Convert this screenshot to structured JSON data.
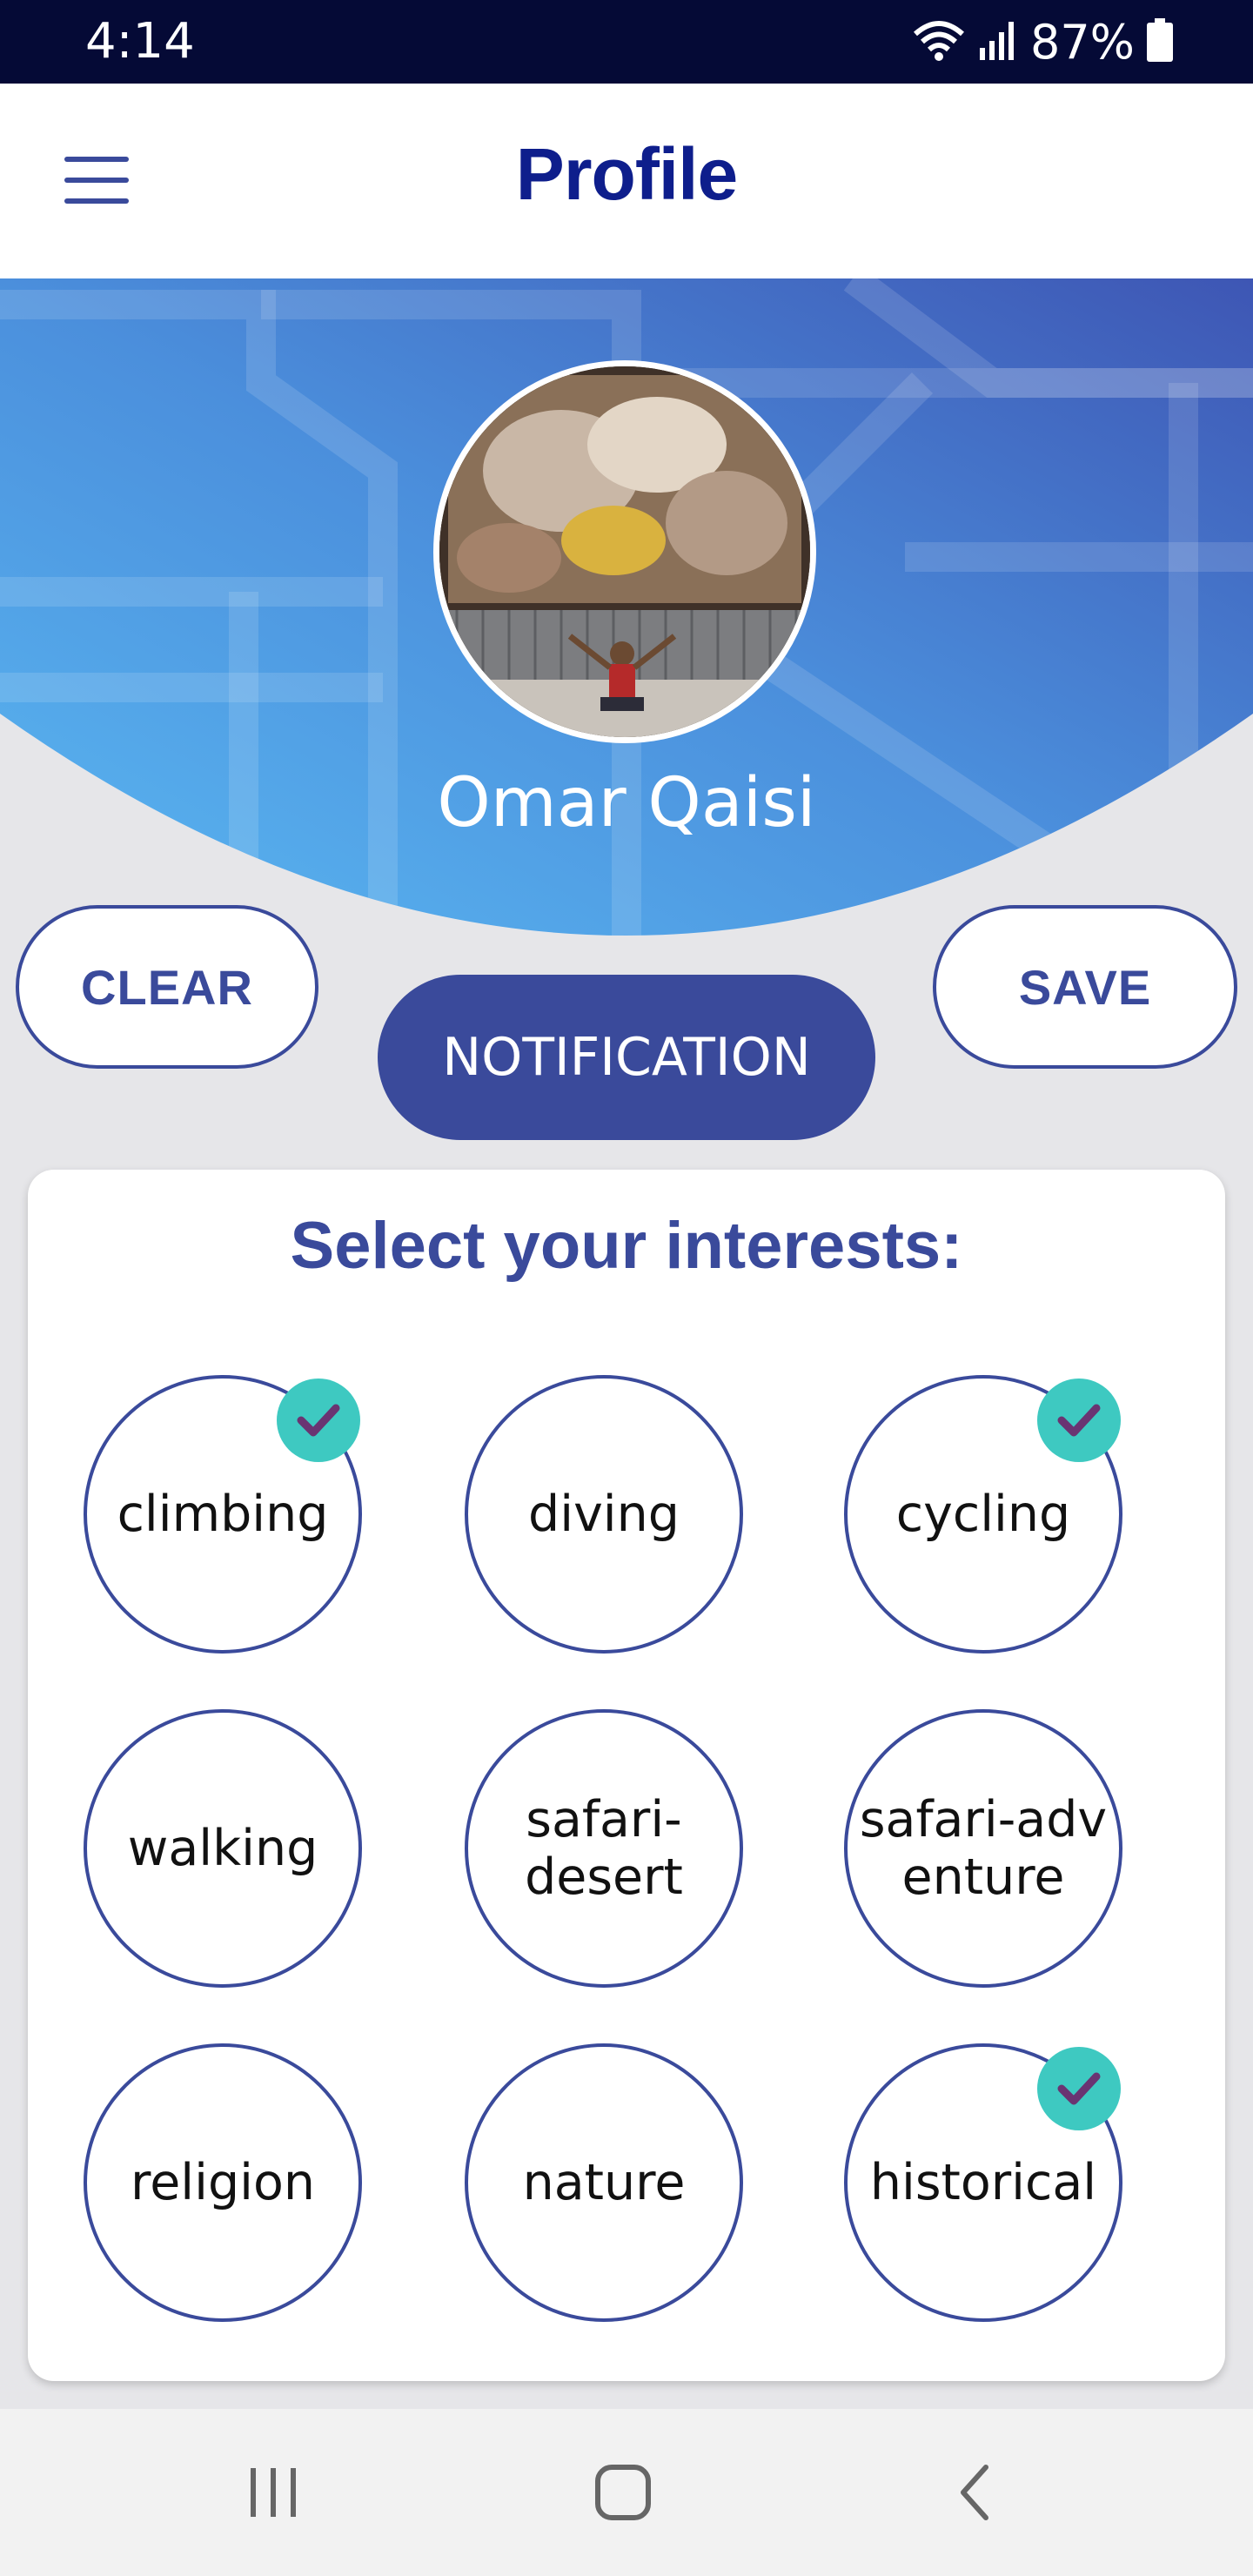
{
  "status_bar": {
    "time": "4:14",
    "battery": "87%",
    "icons": [
      "wifi-icon",
      "signal-icon",
      "battery-icon"
    ]
  },
  "header": {
    "title": "Profile",
    "menu_icon": "hamburger-menu-icon"
  },
  "profile": {
    "name": "Omar Qaisi",
    "avatar": "profile-photo"
  },
  "actions": {
    "clear_label": "CLEAR",
    "notification_label": "NOTIFICATION",
    "save_label": "SAVE"
  },
  "interests": {
    "title": "Select your interests:",
    "items": [
      {
        "label": "climbing",
        "selected": true
      },
      {
        "label": "diving",
        "selected": false
      },
      {
        "label": "cycling",
        "selected": true
      },
      {
        "label": "walking",
        "selected": false
      },
      {
        "label": "safari-desert",
        "selected": false
      },
      {
        "label": "safari-adventure",
        "selected": false
      },
      {
        "label": "religion",
        "selected": false
      },
      {
        "label": "nature",
        "selected": false
      },
      {
        "label": "historical",
        "selected": true
      }
    ]
  },
  "nav_bar": {
    "items": [
      "recents-icon",
      "home-icon",
      "back-icon"
    ]
  },
  "colors": {
    "primary": "#3a4a9b",
    "title": "#0e1e8c",
    "check": "#3ec9c1",
    "check_mark": "#6a3472",
    "status_bar": "#050a36"
  }
}
